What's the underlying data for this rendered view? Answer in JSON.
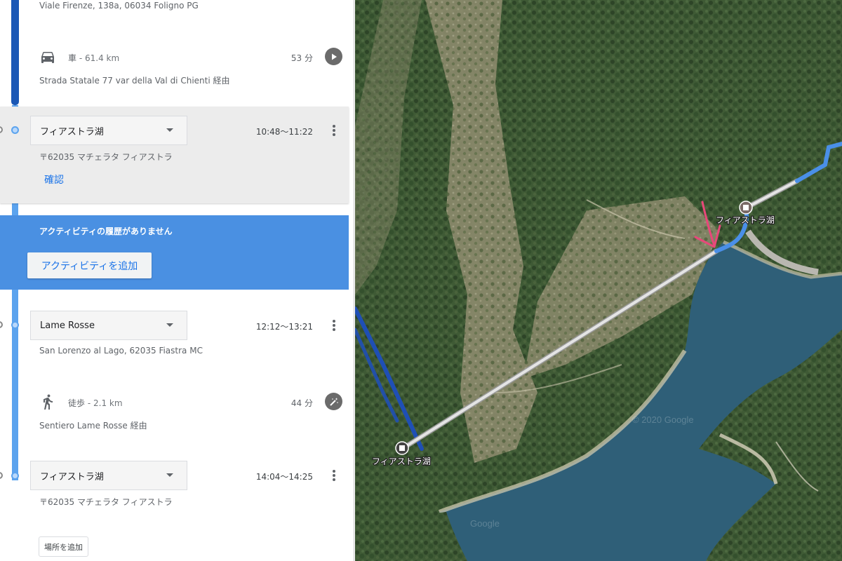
{
  "timeline": {
    "start_address": "Viale Firenze, 138a, 06034 Foligno PG",
    "legs": [
      {
        "mode": "車",
        "distance": "- 61.4 km",
        "duration": "53 分",
        "via": "Strada Statale 77 var della Val di Chienti 経由",
        "icon": "car-icon",
        "action_icon": "play-icon"
      },
      {
        "mode": "徒歩",
        "distance": "- 2.1 km",
        "duration": "44 分",
        "via": "Sentiero Lame Rosse 経由",
        "icon": "walk-icon",
        "action_icon": "magic-wand-icon"
      }
    ],
    "stops": [
      {
        "name": "フィアストラ湖",
        "time": "10:48〜11:22",
        "address": "〒62035 マチェラタ フィアストラ",
        "confirm": "確認"
      },
      {
        "name": "Lame Rosse",
        "time": "12:12〜13:21",
        "address": "San Lorenzo al Lago, 62035 Fiastra MC"
      },
      {
        "name": "フィアストラ湖",
        "time": "14:04〜14:25",
        "address": "〒62035 マチェラタ フィアストラ"
      }
    ],
    "activity": {
      "message": "アクティビティの履歴がありません",
      "button": "アクティビティを追加"
    },
    "add_place": "場所を追加"
  },
  "map": {
    "labels": [
      "フィアストラ湖",
      "フィアストラ湖"
    ],
    "watermarks": [
      "© 2020 Google",
      "Google"
    ],
    "colors": {
      "route_dark": "#1f4fb5",
      "route_light": "#4a8fe8",
      "route_walked": "#d9d9d9",
      "lake": "#2f5f78",
      "forest": "#3e5633",
      "arrow": "#e8487a"
    }
  },
  "colors": {
    "accent": "#1a73e8",
    "timeline_dark": "#1a57b5",
    "timeline_light": "#5ba3ee",
    "activity_card": "#4a90e2"
  }
}
